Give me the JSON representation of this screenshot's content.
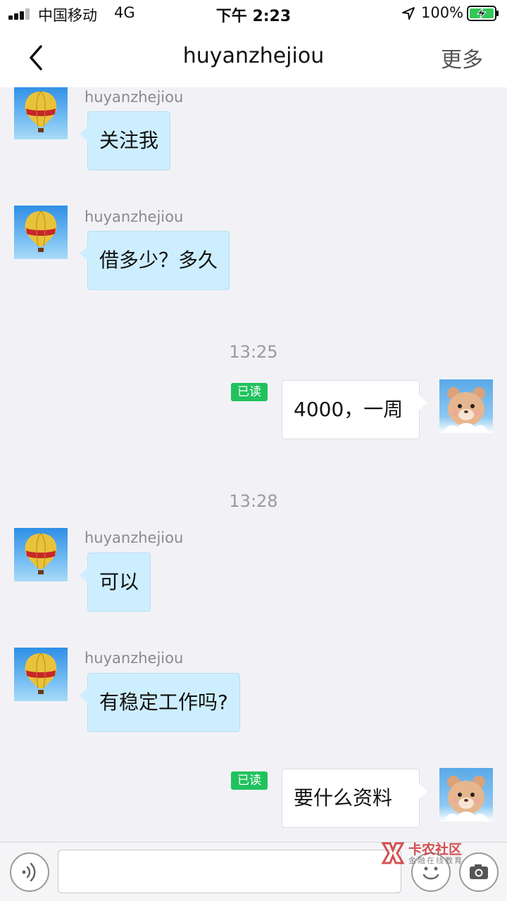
{
  "status_bar": {
    "carrier": "中国移动",
    "network": "4G",
    "time": "下午 2:23",
    "battery_percent": "100%"
  },
  "nav": {
    "title": "huyanzhejiou",
    "more_label": "更多"
  },
  "messages": [
    {
      "type": "incoming",
      "sender": "huyanzhejiou",
      "text": "关注我"
    },
    {
      "type": "incoming",
      "sender": "huyanzhejiou",
      "text": "借多少？多久"
    },
    {
      "type": "timestamp",
      "text": "13:25"
    },
    {
      "type": "outgoing",
      "read_label": "已读",
      "text": "4000，一周"
    },
    {
      "type": "timestamp",
      "text": "13:28"
    },
    {
      "type": "incoming",
      "sender": "huyanzhejiou",
      "text": "可以"
    },
    {
      "type": "incoming",
      "sender": "huyanzhejiou",
      "text": "有稳定工作吗?"
    },
    {
      "type": "outgoing",
      "read_label": "已读",
      "text": "要什么资料"
    }
  ],
  "input_bar": {
    "text_value": ""
  },
  "watermark": {
    "title": "卡农社区",
    "subtitle": "金融在线教育"
  },
  "colors": {
    "incoming_bubble": "#cdeefe",
    "outgoing_bubble": "#ffffff",
    "read_badge": "#21c25e",
    "background": "#f2f2f6"
  }
}
